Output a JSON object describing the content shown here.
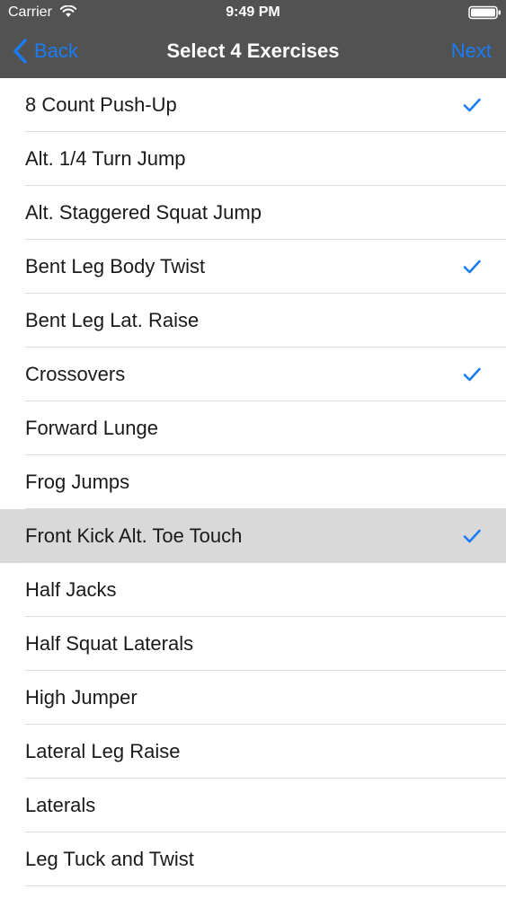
{
  "status_bar": {
    "carrier": "Carrier",
    "time": "9:49 PM",
    "icons": [
      "wifi-icon",
      "battery-icon"
    ]
  },
  "nav_bar": {
    "back_label": "Back",
    "title": "Select 4 Exercises",
    "next_label": "Next",
    "background_color": "#525252",
    "accent_color": "#1a7cf5"
  },
  "exercises": [
    {
      "label": "8 Count Push-Up",
      "checked": true,
      "highlighted": false
    },
    {
      "label": "Alt. 1/4 Turn Jump",
      "checked": false,
      "highlighted": false
    },
    {
      "label": "Alt. Staggered Squat Jump",
      "checked": false,
      "highlighted": false
    },
    {
      "label": "Bent Leg Body Twist",
      "checked": true,
      "highlighted": false
    },
    {
      "label": "Bent Leg Lat. Raise",
      "checked": false,
      "highlighted": false
    },
    {
      "label": "Crossovers",
      "checked": true,
      "highlighted": false
    },
    {
      "label": "Forward Lunge",
      "checked": false,
      "highlighted": false
    },
    {
      "label": "Frog Jumps",
      "checked": false,
      "highlighted": false
    },
    {
      "label": "Front Kick Alt. Toe Touch",
      "checked": true,
      "highlighted": true
    },
    {
      "label": "Half Jacks",
      "checked": false,
      "highlighted": false
    },
    {
      "label": "Half Squat Laterals",
      "checked": false,
      "highlighted": false
    },
    {
      "label": "High Jumper",
      "checked": false,
      "highlighted": false
    },
    {
      "label": "Lateral Leg Raise",
      "checked": false,
      "highlighted": false
    },
    {
      "label": "Laterals",
      "checked": false,
      "highlighted": false
    },
    {
      "label": "Leg Tuck and Twist",
      "checked": false,
      "highlighted": false
    }
  ]
}
